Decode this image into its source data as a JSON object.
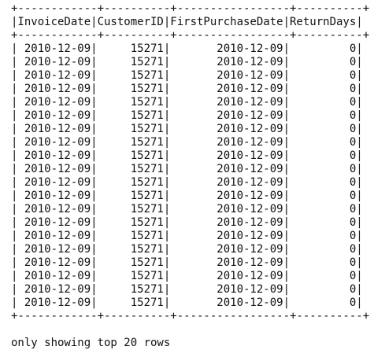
{
  "table": {
    "border": "+------------+----------+-----------------+----------+",
    "header": "|InvoiceDate|CustomerID|FirstPurchaseDate|ReturnDays|",
    "rows": [
      "| 2010-12-09|     15271|       2010-12-09|         0|",
      "| 2010-12-09|     15271|       2010-12-09|         0|",
      "| 2010-12-09|     15271|       2010-12-09|         0|",
      "| 2010-12-09|     15271|       2010-12-09|         0|",
      "| 2010-12-09|     15271|       2010-12-09|         0|",
      "| 2010-12-09|     15271|       2010-12-09|         0|",
      "| 2010-12-09|     15271|       2010-12-09|         0|",
      "| 2010-12-09|     15271|       2010-12-09|         0|",
      "| 2010-12-09|     15271|       2010-12-09|         0|",
      "| 2010-12-09|     15271|       2010-12-09|         0|",
      "| 2010-12-09|     15271|       2010-12-09|         0|",
      "| 2010-12-09|     15271|       2010-12-09|         0|",
      "| 2010-12-09|     15271|       2010-12-09|         0|",
      "| 2010-12-09|     15271|       2010-12-09|         0|",
      "| 2010-12-09|     15271|       2010-12-09|         0|",
      "| 2010-12-09|     15271|       2010-12-09|         0|",
      "| 2010-12-09|     15271|       2010-12-09|         0|",
      "| 2010-12-09|     15271|       2010-12-09|         0|",
      "| 2010-12-09|     15271|       2010-12-09|         0|",
      "| 2010-12-09|     15271|       2010-12-09|         0|"
    ]
  },
  "footer": "only showing top 20 rows"
}
